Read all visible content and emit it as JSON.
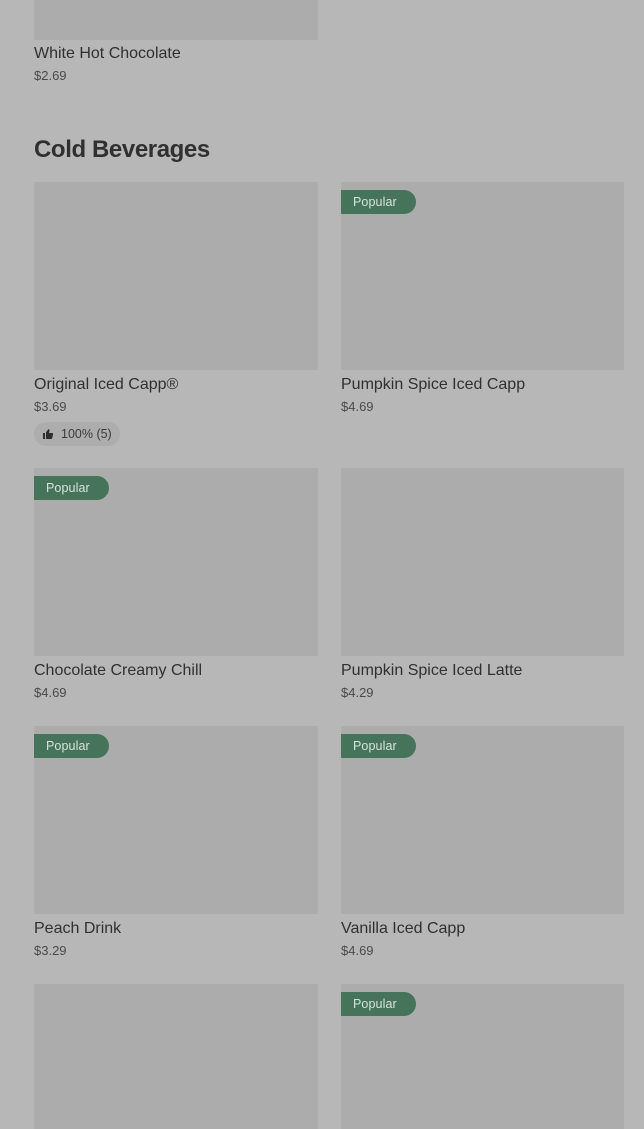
{
  "previous_item": {
    "name": "White Hot Chocolate",
    "price": "$2.69"
  },
  "section": {
    "title": "Cold Beverages"
  },
  "items": [
    {
      "name": "Original Iced Capp®",
      "price": "$3.69",
      "badge": "",
      "rating": "100% (5)"
    },
    {
      "name": "Pumpkin Spice Iced Capp",
      "price": "$4.69",
      "badge": "Popular",
      "rating": ""
    },
    {
      "name": "Chocolate Creamy Chill",
      "price": "$4.69",
      "badge": "Popular",
      "rating": ""
    },
    {
      "name": "Pumpkin Spice Iced Latte",
      "price": "$4.29",
      "badge": "",
      "rating": ""
    },
    {
      "name": "Peach Drink",
      "price": "$3.29",
      "badge": "Popular",
      "rating": ""
    },
    {
      "name": "Vanilla Iced Capp",
      "price": "$4.69",
      "badge": "Popular",
      "rating": ""
    },
    {
      "name": "",
      "price": "",
      "badge": "",
      "rating": ""
    },
    {
      "name": "",
      "price": "",
      "badge": "Popular",
      "rating": ""
    }
  ],
  "icons": {
    "rating": "thumbs-up-icon"
  },
  "colors": {
    "background": "#b7b7b7",
    "image_placeholder": "#acacac",
    "badge_bg": "#46745a",
    "badge_text": "#d7e2db"
  }
}
